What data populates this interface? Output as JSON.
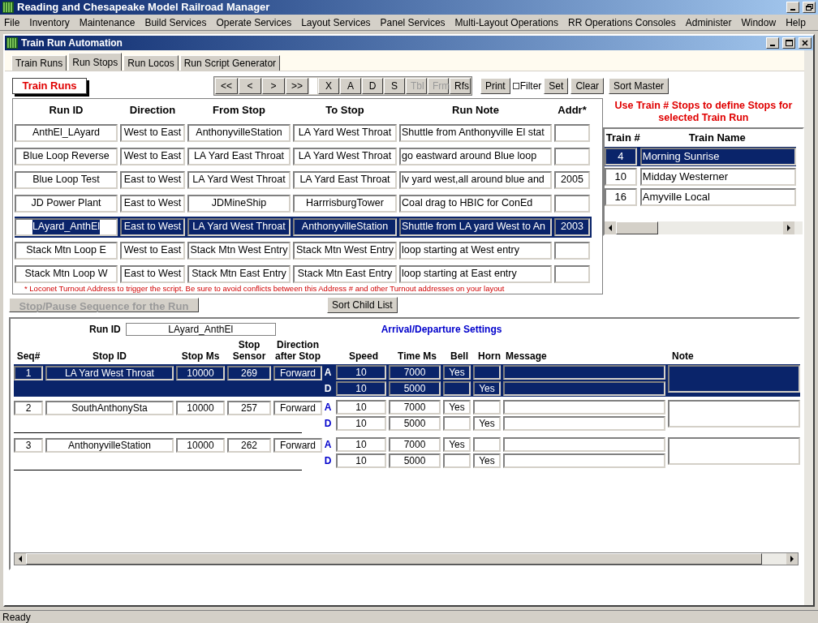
{
  "app_title": "Reading and Chesapeake Model Railroad Manager",
  "menu": [
    "File",
    "Inventory",
    "Maintenance",
    "Build Services",
    "Operate Services",
    "Layout Services",
    "Panel Services",
    "Multi-Layout Operations",
    "RR Operations Consoles",
    "Administer",
    "Window",
    "Help"
  ],
  "window": {
    "title": "Train Run Automation"
  },
  "tabs": [
    {
      "label": "Train Runs",
      "selected": false
    },
    {
      "label": "Run Stops",
      "selected": true
    },
    {
      "label": "Run Locos",
      "selected": false
    },
    {
      "label": "Run Script Generator",
      "selected": false
    }
  ],
  "master": {
    "title": "Train Runs",
    "nav_buttons": [
      {
        "label": "<<",
        "disabled": false
      },
      {
        "label": "<",
        "disabled": false
      },
      {
        "label": ">",
        "disabled": false
      },
      {
        "label": ">>",
        "disabled": false
      }
    ],
    "edit_buttons": [
      {
        "label": "X",
        "disabled": false
      },
      {
        "label": "A",
        "disabled": false
      },
      {
        "label": "D",
        "disabled": false
      },
      {
        "label": "S",
        "disabled": false
      },
      {
        "label": "Tbl",
        "disabled": true
      },
      {
        "label": "Frm",
        "disabled": true
      },
      {
        "label": "Rfs",
        "disabled": false
      }
    ],
    "print_button": "Print",
    "filter": {
      "label": "Filter",
      "checked": false
    },
    "set_button": "Set",
    "clear_button": "Clear",
    "sort_button": "Sort Master",
    "columns": [
      "Run ID",
      "Direction",
      "From Stop",
      "To Stop",
      "Run Note",
      "Addr*"
    ],
    "rows": [
      {
        "cells": [
          "AnthEl_LAyard",
          "West to East",
          "AnthonyvilleStation",
          "LA Yard West Throat",
          "Shuttle from Anthonyville El stat",
          ""
        ],
        "selected": false
      },
      {
        "cells": [
          "Blue Loop Reverse",
          "West to East",
          "LA Yard East Throat",
          "LA Yard West Throat",
          "go eastward around Blue loop",
          ""
        ],
        "selected": false
      },
      {
        "cells": [
          "Blue Loop Test",
          "East to West",
          "LA Yard West Throat",
          "LA Yard East Throat",
          "lv yard west,all around blue and",
          "2005"
        ],
        "selected": false
      },
      {
        "cells": [
          "JD Power Plant",
          "East to West",
          "JDMineShip",
          "HarrrisburgTower",
          "Coal drag to HBIC for ConEd",
          ""
        ],
        "selected": false
      },
      {
        "cells": [
          "LAyard_AnthEl",
          "East to West",
          "LA Yard West Throat",
          "AnthonyvilleStation",
          "Shuttle from LA yard West to An",
          "2003"
        ],
        "selected": true
      },
      {
        "cells": [
          "Stack Mtn Loop E",
          "West to East",
          "Stack Mtn West Entry",
          "Stack Mtn West Entry",
          "loop starting at West entry",
          ""
        ],
        "selected": false
      },
      {
        "cells": [
          "Stack Mtn Loop W",
          "East to West",
          "Stack Mtn East Entry",
          "Stack Mtn East Entry",
          "loop starting at East entry",
          ""
        ],
        "selected": false
      }
    ],
    "footnote": "*  Loconet Turnout Address to trigger the script. Be sure to avoid conflicts between this Address # and other Turnout addresses on your layout"
  },
  "hint": "Use Train # Stops to define Stops for selected Train Run",
  "trains": {
    "columns": [
      "Train #",
      "Train Name"
    ],
    "rows": [
      {
        "number": "4",
        "name": "Morning Sunrise",
        "selected": true
      },
      {
        "number": "10",
        "name": "Midday Westerner",
        "selected": false
      },
      {
        "number": "16",
        "name": "Amyville Local",
        "selected": false
      }
    ]
  },
  "stop_pause_button": {
    "label": "Stop/Pause Sequence for the Run",
    "disabled": true
  },
  "sort_child_button": "Sort Child List",
  "child": {
    "run_id_label": "Run ID",
    "run_id": "LAyard_AnthEl",
    "settings_title": "Arrival/Departure Settings",
    "columns": [
      "Seq#",
      "Stop ID",
      "Stop Ms",
      "Stop Sensor",
      "Direction after Stop",
      "Speed",
      "Time Ms",
      "Bell",
      "Horn",
      "Message",
      "Note"
    ],
    "stops": [
      {
        "seq": "1",
        "stop_id": "LA Yard West Throat",
        "stop_ms": "10000",
        "sensor": "269",
        "direction": "Forward",
        "selected": true,
        "phases": [
          {
            "label": "A",
            "speed": "10",
            "time": "7000",
            "bell": "Yes"
          },
          {
            "label": "D",
            "speed": "10",
            "time": "5000",
            "horn": "Yes"
          }
        ]
      },
      {
        "seq": "2",
        "stop_id": "SouthAnthonySta",
        "stop_ms": "10000",
        "sensor": "257",
        "direction": "Forward",
        "selected": false,
        "phases": [
          {
            "label": "A",
            "speed": "10",
            "time": "7000",
            "bell": "Yes"
          },
          {
            "label": "D",
            "speed": "10",
            "time": "5000",
            "horn": "Yes"
          }
        ]
      },
      {
        "seq": "3",
        "stop_id": "AnthonyvilleStation",
        "stop_ms": "10000",
        "sensor": "262",
        "direction": "Forward",
        "selected": false,
        "phases": [
          {
            "label": "A",
            "speed": "10",
            "time": "7000",
            "bell": "Yes"
          },
          {
            "label": "D",
            "speed": "10",
            "time": "5000",
            "horn": "Yes"
          }
        ]
      }
    ]
  },
  "status_bar": "Ready"
}
